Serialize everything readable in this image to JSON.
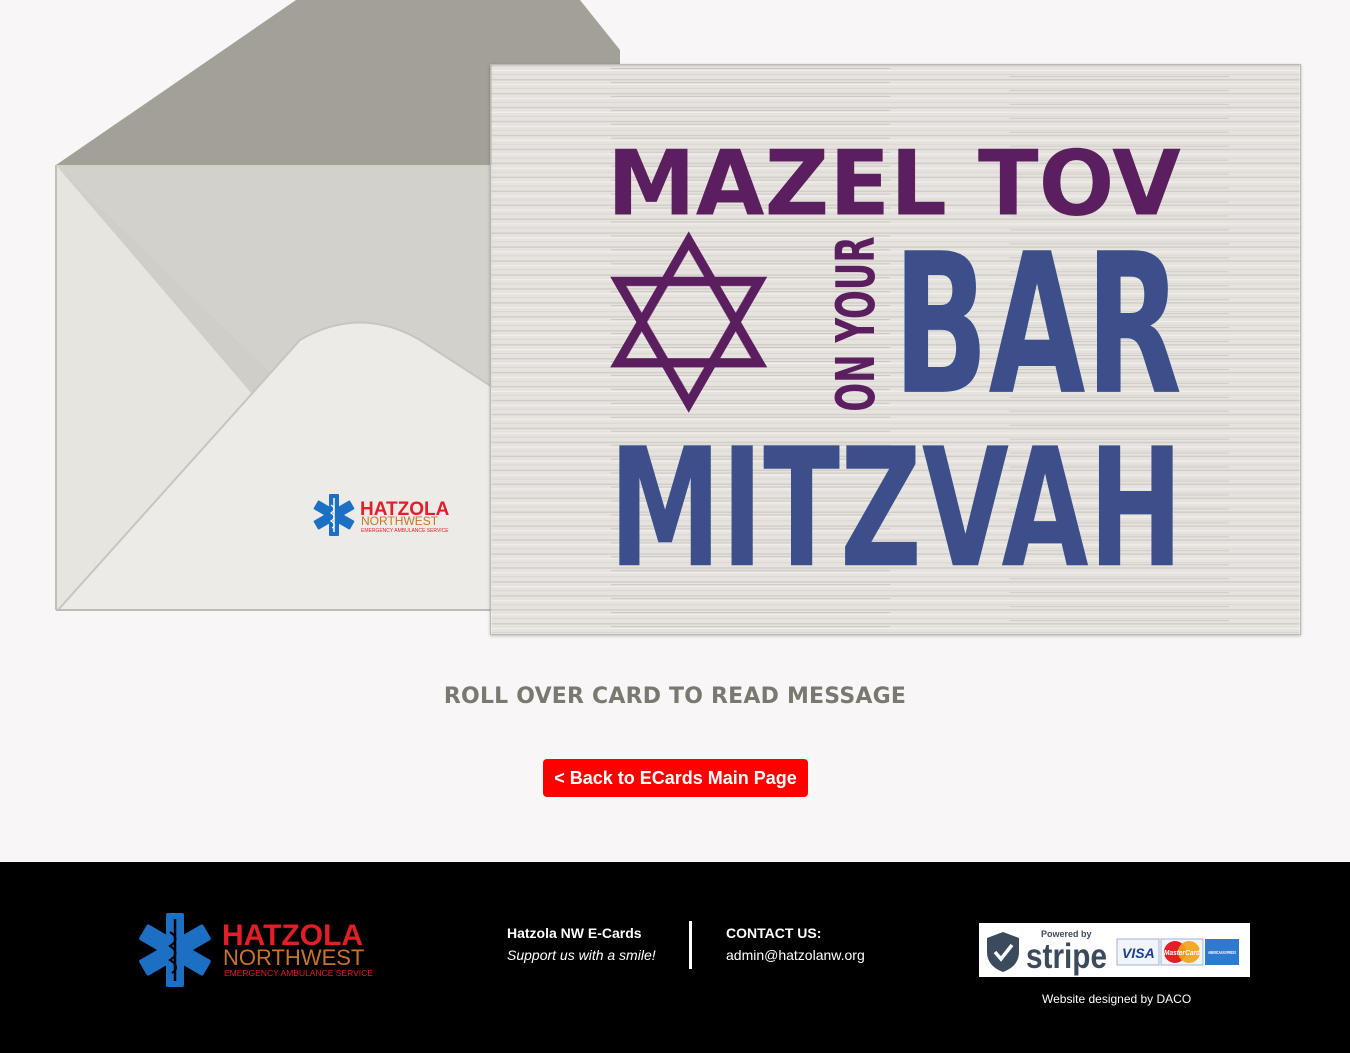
{
  "card": {
    "line1": "MAZEL TOV",
    "vertical": "ON YOUR",
    "line2": "BAR",
    "line3": "MITZVAH"
  },
  "envelope_logo": {
    "name": "HATZOLA",
    "region": "NORTHWEST",
    "tagline": "EMERGENCY AMBULANCE SERVICE"
  },
  "instruction": "ROLL OVER CARD TO READ MESSAGE",
  "back_button": "< Back to ECards Main Page",
  "footer": {
    "logo": {
      "name": "HATZOLA",
      "region": "NORTHWEST",
      "tagline": "EMERGENCY AMBULANCE SERVICE"
    },
    "site_title": "Hatzola NW E-Cards",
    "site_subtitle": "Support us with a smile!",
    "contact_label": "CONTACT US:",
    "contact_email": "admin@hatzolanw.org",
    "stripe": {
      "powered": "Powered by",
      "brand": "stripe",
      "cards": [
        "VISA",
        "MasterCard",
        "AMERICAN EXPRESS"
      ]
    },
    "credit": "Website designed by DACO"
  },
  "colors": {
    "purple": "#5b1e5e",
    "blue": "#3d4f8a",
    "red_button": "#ff0000",
    "footer_bg": "#000000",
    "logo_red": "#e21e26",
    "logo_orange": "#c8742c",
    "logo_blue": "#1d6fc4"
  }
}
